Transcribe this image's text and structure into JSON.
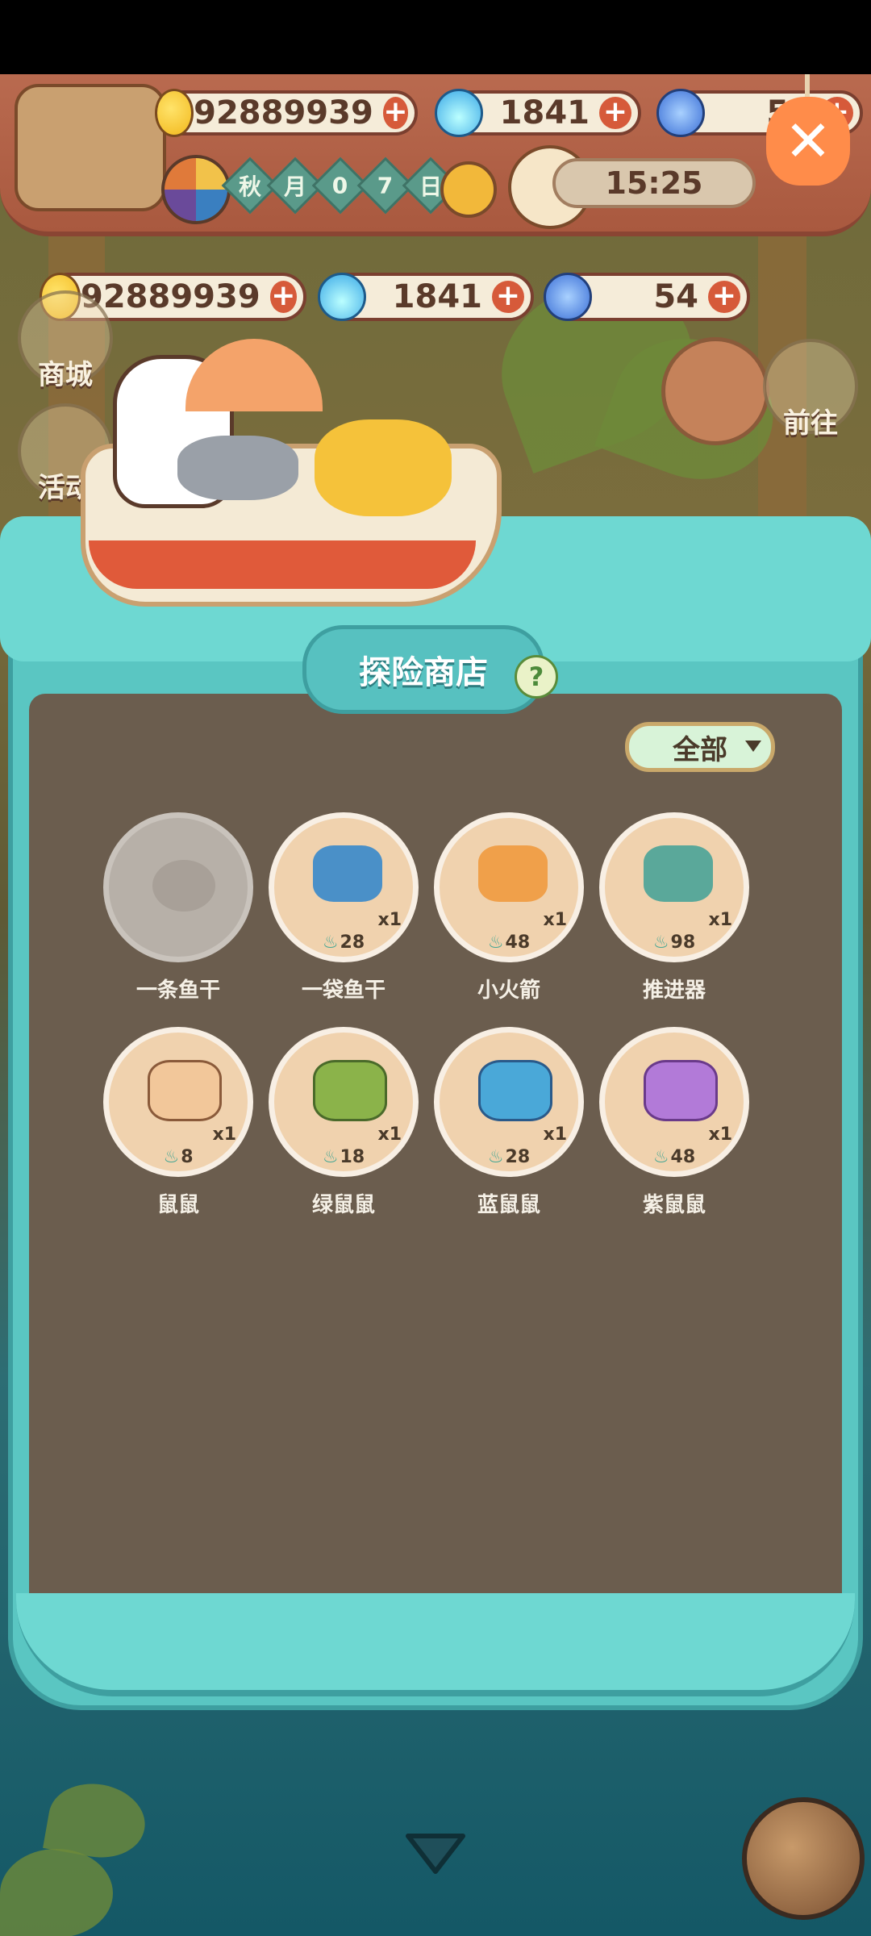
{
  "header": {
    "bananas": "92889939",
    "flames": "1841",
    "fish": "54",
    "calendar": {
      "season": "秋",
      "month_label": "月",
      "d1": "0",
      "d2": "7",
      "day_label": "日"
    },
    "clock": "15:25"
  },
  "currency_bar": {
    "bananas": "92889939",
    "flames": "1841",
    "fish": "54"
  },
  "side_buttons": {
    "shop": "商城",
    "events": "活动",
    "goto": "前往"
  },
  "shop": {
    "title": "探险商店",
    "help": "?",
    "filter": "全部",
    "items": [
      {
        "name": "一条鱼干",
        "qty": "",
        "price": "",
        "locked": true
      },
      {
        "name": "一袋鱼干",
        "qty": "x1",
        "price": "28"
      },
      {
        "name": "小火箭",
        "qty": "x1",
        "price": "48"
      },
      {
        "name": "推进器",
        "qty": "x1",
        "price": "98"
      },
      {
        "name": "鼠鼠",
        "qty": "x1",
        "price": "8"
      },
      {
        "name": "绿鼠鼠",
        "qty": "x1",
        "price": "18"
      },
      {
        "name": "蓝鼠鼠",
        "qty": "x1",
        "price": "28"
      },
      {
        "name": "紫鼠鼠",
        "qty": "x1",
        "price": "48"
      }
    ]
  },
  "colors": {
    "panel_teal": "#5ac6c2",
    "panel_inner": "#6b5d4e",
    "header_brown": "#b96a4f",
    "mouse_beige": "#f2c79a",
    "mouse_green": "#8bb34a",
    "mouse_blue": "#4aa8d8",
    "mouse_purple": "#b27ad8"
  }
}
